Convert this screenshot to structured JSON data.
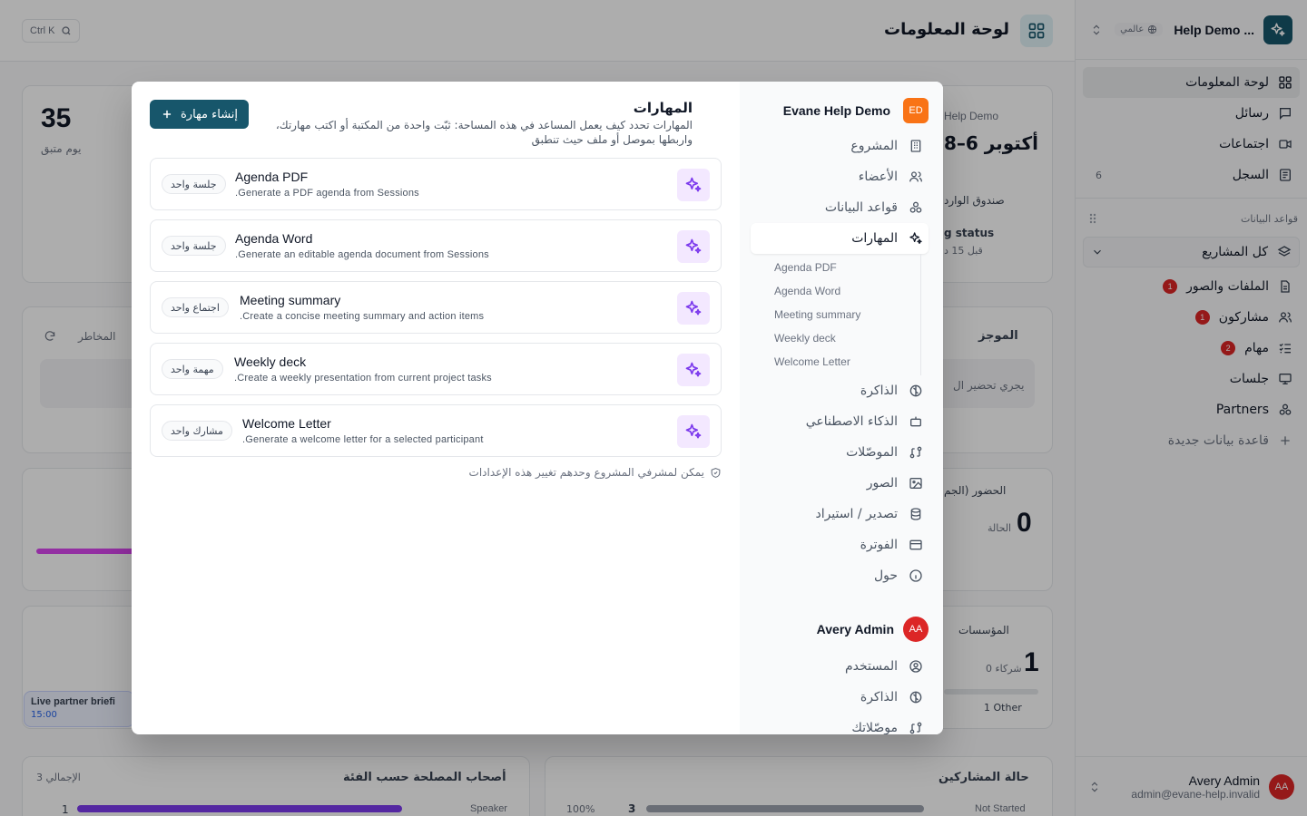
{
  "sidebar": {
    "app_title": "Help Demo ...",
    "scope_badge": "عالمي",
    "nav": [
      {
        "label": "لوحة المعلومات",
        "icon": "dashboard-icon",
        "active": true
      },
      {
        "label": "رسائل",
        "icon": "message-icon"
      },
      {
        "label": "اجتماعات",
        "icon": "video-icon"
      },
      {
        "label": "السجل",
        "icon": "log-icon",
        "count": "6"
      }
    ],
    "databases_heading": "قواعد البيانات",
    "project_select": "كل المشاريع",
    "databases": [
      {
        "label": "الملفات والصور",
        "icon": "file-icon",
        "badge": "1"
      },
      {
        "label": "مشاركون",
        "icon": "users-icon",
        "badge": "1"
      },
      {
        "label": "مهام",
        "icon": "tasks-icon",
        "badge": "2"
      },
      {
        "label": "جلسات",
        "icon": "presentation-icon"
      },
      {
        "label": "Partners",
        "icon": "partners-icon"
      }
    ],
    "new_database": "قاعدة بيانات جديدة",
    "user": {
      "initials": "AA",
      "name": "Avery Admin",
      "email": "admin@evane-help.invalid"
    }
  },
  "topbar": {
    "title": "لوحة المعلومات",
    "search_shortcut": "Ctrl K"
  },
  "background": {
    "days_value": "35",
    "days_label": "يوم متبق",
    "org_label": "Help Demo",
    "date_range": "أكتوبر 6–8",
    "inbox_label": "صندوق الوارد",
    "status_label": "g status",
    "status_time": "قبل 15 د",
    "risks_label": "المخاطر",
    "summary_label": "الموجز",
    "summary_text": "يجري تحضير ال",
    "attendance_label": "الحضور (الجم",
    "attendance_value": "0",
    "attendance_sub": "الحالة",
    "orgs_label": "المؤسسات",
    "orgs_value": "1",
    "orgs_sub": "0 شركاء",
    "other_label": "1 Other",
    "event_title": "Live partner briefi",
    "event_time": "15:00",
    "stakeholders_title": "أصحاب المصلحة حسب الفئة",
    "stakeholders_total": "3 الإجمالي",
    "stakeholders_row_label": "Speaker",
    "stakeholders_row_value": "1",
    "participants_title": "حالة المشاركين",
    "participants_pct": "100%",
    "participants_value": "3",
    "participants_row_label": "Not Started"
  },
  "modal": {
    "org_initials": "ED",
    "org_name": "Evane Help Demo",
    "nav": [
      {
        "label": "المشروع",
        "icon": "building-icon"
      },
      {
        "label": "الأعضاء",
        "icon": "users-icon"
      },
      {
        "label": "قواعد البيانات",
        "icon": "databases-icon"
      },
      {
        "label": "المهارات",
        "icon": "sparkle-icon",
        "active": true
      }
    ],
    "subnav": [
      "Agenda PDF",
      "Agenda Word",
      "Meeting summary",
      "Weekly deck",
      "Welcome Letter"
    ],
    "nav2": [
      {
        "label": "الذاكرة",
        "icon": "brain-icon"
      },
      {
        "label": "الذكاء الاصطناعي",
        "icon": "bot-icon"
      },
      {
        "label": "الموصّلات",
        "icon": "plug-icon"
      },
      {
        "label": "الصور",
        "icon": "image-icon"
      },
      {
        "label": "تصدير / استيراد",
        "icon": "database-icon"
      },
      {
        "label": "الفوترة",
        "icon": "card-icon"
      },
      {
        "label": "حول",
        "icon": "info-icon"
      }
    ],
    "user_initials": "AA",
    "user_name": "Avery Admin",
    "user_nav": [
      {
        "label": "المستخدم",
        "icon": "user-circle-icon"
      },
      {
        "label": "الذاكرة",
        "icon": "brain-icon"
      },
      {
        "label": "موصّلاتك",
        "icon": "plug-icon"
      }
    ],
    "title": "المهارات",
    "description": "المهارات تحدد كيف يعمل المساعد في هذه المساحة: ثبّت واحدة من المكتبة أو اكتب مهارتك، واربطها بموصل أو ملف حيث تنطبق",
    "create_button": "إنشاء مهارة",
    "skills": [
      {
        "name": "Agenda PDF",
        "desc": "Generate a PDF agenda from Sessions.",
        "scope": "جلسة واحد"
      },
      {
        "name": "Agenda Word",
        "desc": "Generate an editable agenda document from Sessions.",
        "scope": "جلسة واحد"
      },
      {
        "name": "Meeting summary",
        "desc": "Create a concise meeting summary and action items.",
        "scope": "اجتماع واحد"
      },
      {
        "name": "Weekly deck",
        "desc": "Create a weekly presentation from current project tasks.",
        "scope": "مهمة واحد"
      },
      {
        "name": "Welcome Letter",
        "desc": "Generate a welcome letter for a selected participant.",
        "scope": "مشارك واحد"
      }
    ],
    "footer_note": "يمكن لمشرفي المشروع وحدهم تغيير هذه الإعدادات"
  },
  "colors": {
    "brand": "#17566b",
    "accent_purple": "#7c3aed",
    "badge_red": "#dc2626",
    "org_orange": "#f97316"
  }
}
